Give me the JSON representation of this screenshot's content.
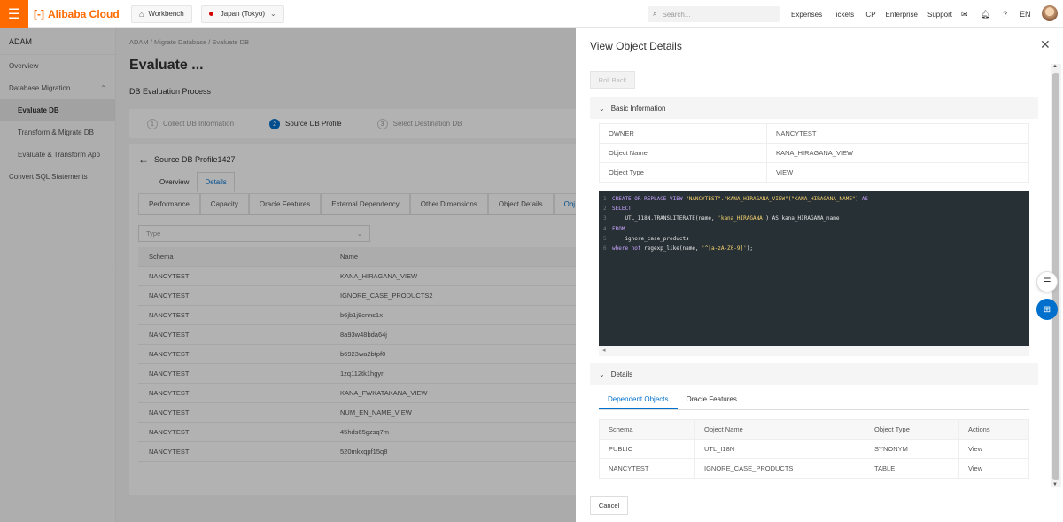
{
  "topbar": {
    "logo_text": "Alibaba Cloud",
    "workbench": "Workbench",
    "region": "Japan (Tokyo)",
    "search_placeholder": "Search...",
    "nav": [
      "Expenses",
      "Tickets",
      "ICP",
      "Enterprise",
      "Support"
    ],
    "lang": "EN"
  },
  "sidebar": {
    "title": "ADAM",
    "items": [
      {
        "label": "Overview"
      },
      {
        "label": "Database Migration"
      },
      {
        "label": "Evaluate DB"
      },
      {
        "label": "Transform & Migrate DB"
      },
      {
        "label": "Evaluate & Transform App"
      },
      {
        "label": "Convert SQL Statements"
      }
    ]
  },
  "main": {
    "breadcrumb": [
      "ADAM",
      "Migrate Database",
      "Evaluate DB"
    ],
    "title": "Evaluate ...",
    "subtitle": "DB Evaluation Process",
    "steps": [
      {
        "num": "1",
        "label": "Collect DB Information"
      },
      {
        "num": "2",
        "label": "Source DB Profile"
      },
      {
        "num": "3",
        "label": "Select Destination DB"
      }
    ],
    "profile_title": "Source DB Profile1427",
    "tabs": [
      "Overview",
      "Details"
    ],
    "subtabs": [
      "Performance",
      "Capacity",
      "Oracle Features",
      "External Dependency",
      "Other Dimensions",
      "Object Details",
      "Obj"
    ],
    "type_placeholder": "Type",
    "table": {
      "headers": [
        "Schema",
        "Name"
      ],
      "rows": [
        [
          "NANCYTEST",
          "KANA_HIRAGANA_VIEW"
        ],
        [
          "NANCYTEST",
          "IGNORE_CASE_PRODUCTS2"
        ],
        [
          "NANCYTEST",
          "b6jb1j8cnns1x"
        ],
        [
          "NANCYTEST",
          "8a93w48bda64j"
        ],
        [
          "NANCYTEST",
          "b6923wa2btpf0"
        ],
        [
          "NANCYTEST",
          "1zq112tk1hgyr"
        ],
        [
          "NANCYTEST",
          "KANA_FWKATAKANA_VIEW"
        ],
        [
          "NANCYTEST",
          "NUM_EN_NAME_VIEW"
        ],
        [
          "NANCYTEST",
          "45hds65gzsq7m"
        ],
        [
          "NANCYTEST",
          "520mkxqpf15q8"
        ]
      ]
    }
  },
  "drawer": {
    "title": "View Object Details",
    "rollback": "Roll Back",
    "basic_info": "Basic Information",
    "kv": [
      {
        "key": "OWNER",
        "value": "NANCYTEST"
      },
      {
        "key": "Object Name",
        "value": "KANA_HIRAGANA_VIEW"
      },
      {
        "key": "Object Type",
        "value": "VIEW"
      }
    ],
    "code": {
      "l1a": "CREATE OR REPLACE VIEW ",
      "l1b": "\"NANCYTEST\".\"KANA_HIRAGANA_VIEW\"(\"KANA_HIRAGANA_NAME\")",
      "l1c": " AS",
      "l2": "SELECT",
      "l3a": "    UTL_I18N.TRANSLITERATE(name, ",
      "l3b": "'kana_HIRAGANA'",
      "l3c": ") AS kana_HIRAGANA_name",
      "l4": "FROM",
      "l5": "    ignore_case_products",
      "l6a": "where not",
      "l6b": " regexp_like(name, ",
      "l6c": "'^[a-zA-Z0-9]'",
      "l6d": ");"
    },
    "details": "Details",
    "detail_tabs": [
      "Dependent Objects",
      "Oracle Features"
    ],
    "dep_table": {
      "headers": [
        "Schema",
        "Object Name",
        "Object Type",
        "Actions"
      ],
      "rows": [
        [
          "PUBLIC",
          "UTL_I18N",
          "SYNONYM",
          "View"
        ],
        [
          "NANCYTEST",
          "IGNORE_CASE_PRODUCTS",
          "TABLE",
          "View"
        ]
      ]
    },
    "cancel": "Cancel"
  }
}
